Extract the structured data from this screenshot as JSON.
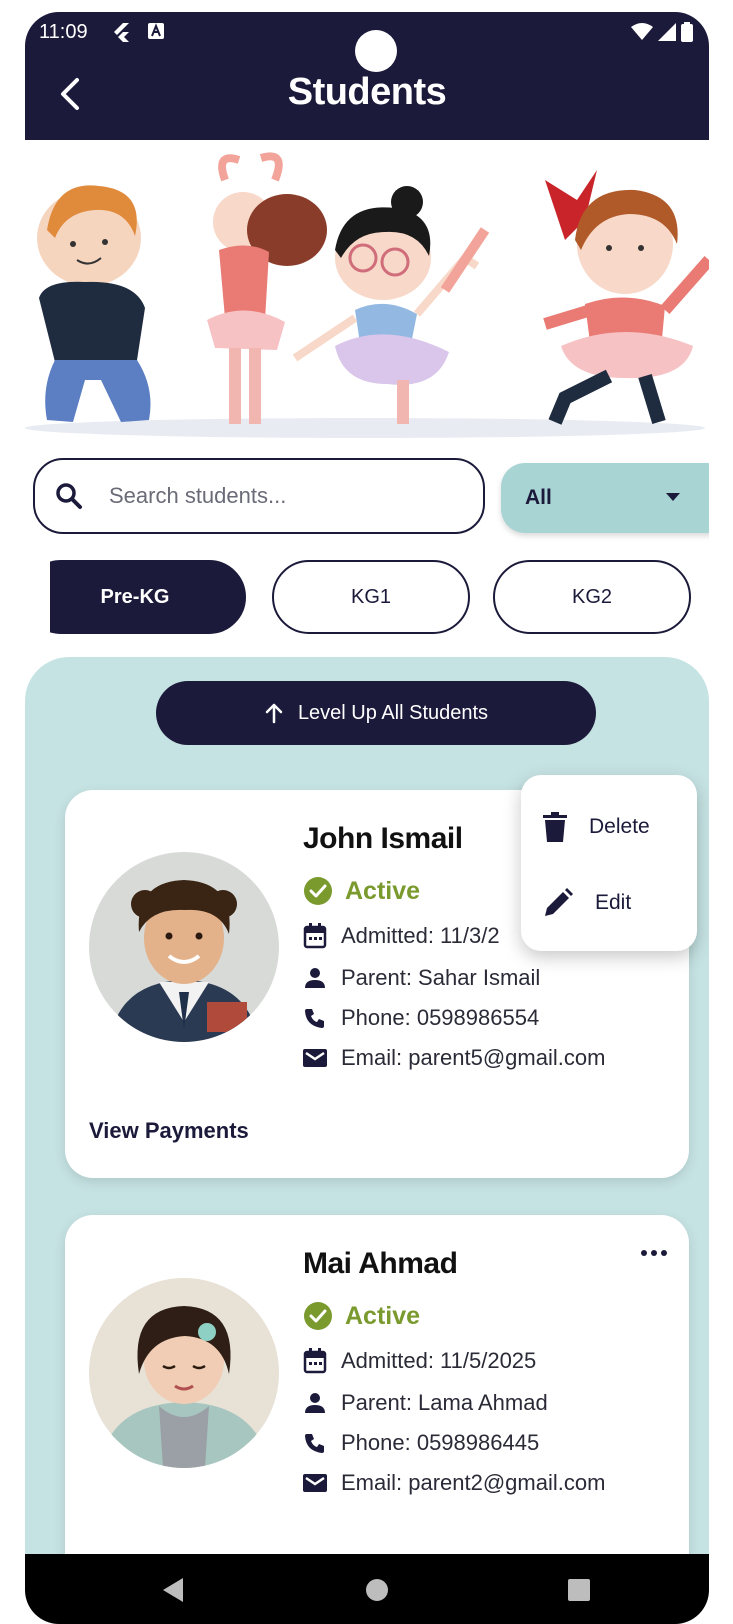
{
  "status_bar": {
    "time": "11:09"
  },
  "header": {
    "title": "Students"
  },
  "search": {
    "placeholder": "Search students..."
  },
  "filter": {
    "selected": "All"
  },
  "level_tabs": [
    {
      "label": "Pre-KG",
      "active": true
    },
    {
      "label": "KG1",
      "active": false
    },
    {
      "label": "KG2",
      "active": false
    }
  ],
  "level_up_label": "Level Up All Students",
  "students": [
    {
      "name": "John Ismail",
      "status": "Active",
      "admitted": "Admitted: 11/3/2",
      "parent": "Parent: Sahar Ismail",
      "phone": "Phone: 0598986554",
      "email": "Email: parent5@gmail.com",
      "view_payments": "View Payments"
    },
    {
      "name": "Mai Ahmad",
      "status": "Active",
      "admitted": "Admitted: 11/5/2025",
      "parent": "Parent: Lama Ahmad",
      "phone": "Phone: 0598986445",
      "email": "Email: parent2@gmail.com"
    }
  ],
  "context_menu": {
    "delete_label": "Delete",
    "edit_label": "Edit"
  },
  "colors": {
    "primary": "#1b1a3a",
    "accent": "#c6e3e3",
    "active_green": "#7a9a2e"
  },
  "icons": [
    "back-arrow-icon",
    "search-icon",
    "caret-down-icon",
    "arrow-up-icon",
    "check-circle-icon",
    "calendar-icon",
    "person-icon",
    "phone-icon",
    "mail-icon",
    "trash-icon",
    "pencil-icon",
    "more-icon"
  ]
}
